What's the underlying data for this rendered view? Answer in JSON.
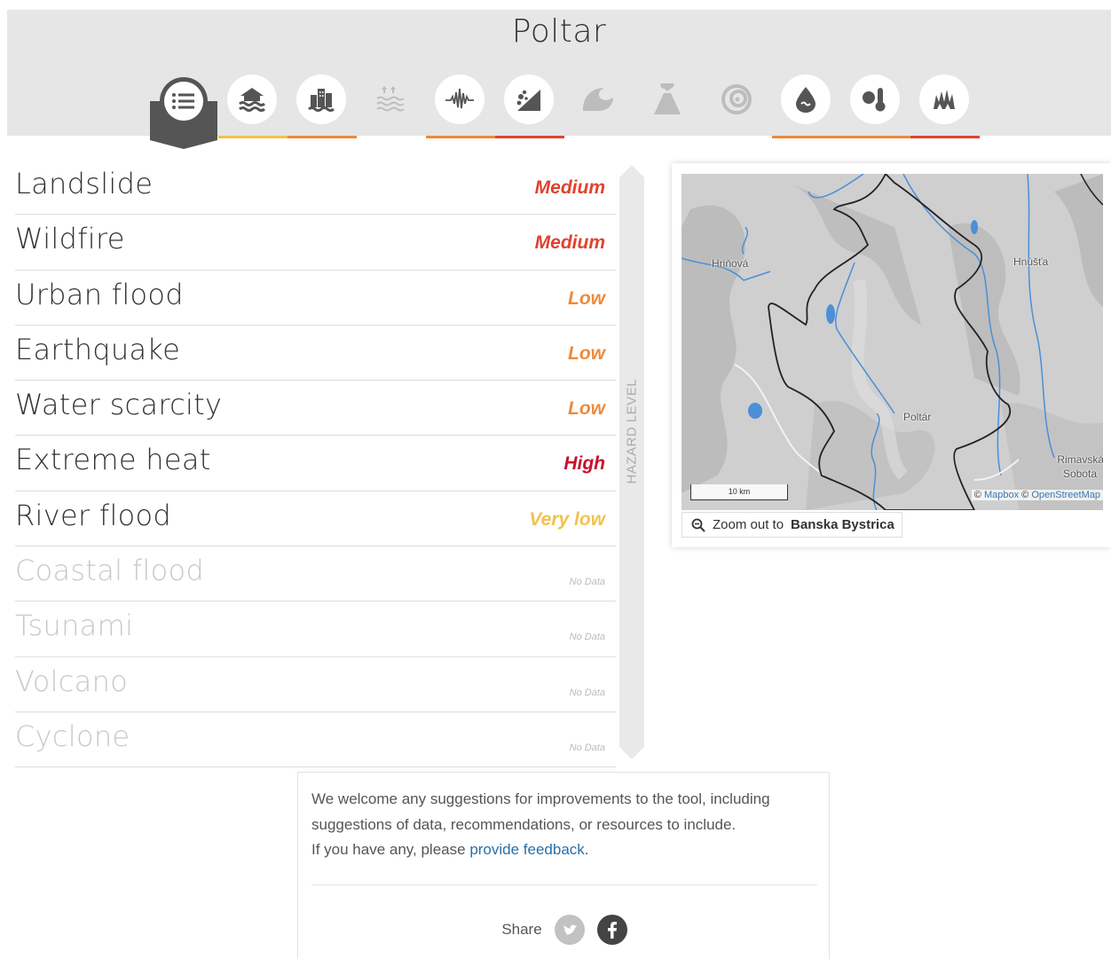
{
  "header": {
    "title": "Poltar",
    "hazard_icons": [
      {
        "name": "list-icon",
        "state": "active"
      },
      {
        "name": "river-flood-icon",
        "underline": "#f2c14e"
      },
      {
        "name": "urban-flood-icon",
        "underline": "#ee8a3a"
      },
      {
        "name": "coastal-flood-icon",
        "underline": ""
      },
      {
        "name": "earthquake-icon",
        "underline": "#ee8a3a"
      },
      {
        "name": "landslide-icon",
        "underline": "#e0422e"
      },
      {
        "name": "tsunami-icon",
        "underline": ""
      },
      {
        "name": "volcano-icon",
        "underline": ""
      },
      {
        "name": "cyclone-icon",
        "underline": ""
      },
      {
        "name": "water-scarcity-icon",
        "underline": "#ee8a3a"
      },
      {
        "name": "extreme-heat-icon",
        "underline": "#ee8a3a"
      },
      {
        "name": "wildfire-icon",
        "underline": "#e0422e"
      }
    ]
  },
  "hazards": [
    {
      "name": "Landslide",
      "level": "Medium",
      "color": "#e0422e",
      "has_data": true
    },
    {
      "name": "Wildfire",
      "level": "Medium",
      "color": "#e0422e",
      "has_data": true
    },
    {
      "name": "Urban flood",
      "level": "Low",
      "color": "#ee8a3a",
      "has_data": true
    },
    {
      "name": "Earthquake",
      "level": "Low",
      "color": "#ee8a3a",
      "has_data": true
    },
    {
      "name": "Water scarcity",
      "level": "Low",
      "color": "#ee8a3a",
      "has_data": true
    },
    {
      "name": "Extreme heat",
      "level": "High",
      "color": "#c7102e",
      "has_data": true
    },
    {
      "name": "River flood",
      "level": "Very low",
      "color": "#f2c14e",
      "has_data": true
    },
    {
      "name": "Coastal flood",
      "level": "No Data",
      "color": "#bbbbbb",
      "has_data": false
    },
    {
      "name": "Tsunami",
      "level": "No Data",
      "color": "#bbbbbb",
      "has_data": false
    },
    {
      "name": "Volcano",
      "level": "No Data",
      "color": "#bbbbbb",
      "has_data": false
    },
    {
      "name": "Cyclone",
      "level": "No Data",
      "color": "#bbbbbb",
      "has_data": false
    }
  ],
  "axis_label": "HAZARD LEVEL",
  "map": {
    "labels": {
      "hrinova": "Hriňová",
      "hnusta": "Hnúšťa",
      "poltar": "Poltár",
      "rimavska1": "Rimavská",
      "rimavska2": "Sobota"
    },
    "scale": "10 km",
    "attribution": {
      "copy1": "©",
      "mapbox": "Mapbox",
      "copy2": "©",
      "osm": "OpenStreetMap"
    },
    "zoom_prefix": "Zoom out to",
    "zoom_target": "Banska Bystrica"
  },
  "feedback": {
    "line1": "We welcome any suggestions for improvements to the tool, including",
    "line2": "suggestions of data, recommendations, or resources to include.",
    "line3_prefix": "If you have any, please",
    "link": "provide feedback",
    "line3_suffix": ".",
    "share_label": "Share"
  },
  "colors": {
    "header_bg": "#e6e6e6",
    "icon_dark": "#555555",
    "icon_faded": "#c4c4c4",
    "link": "#2a6fa8"
  }
}
